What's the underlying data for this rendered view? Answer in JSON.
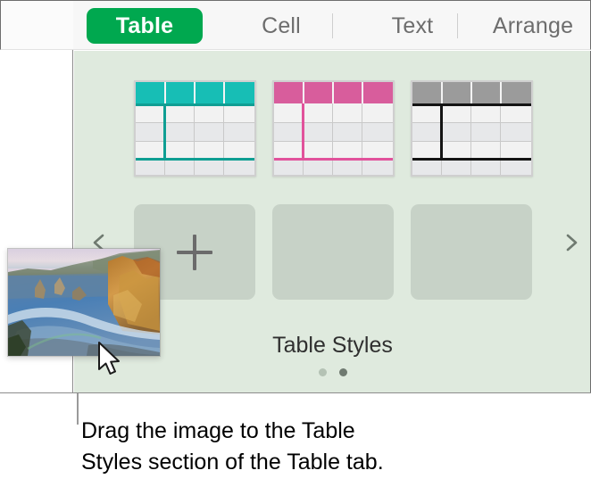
{
  "tabs": [
    {
      "id": "table",
      "label": "Table",
      "selected": true
    },
    {
      "id": "cell",
      "label": "Cell",
      "selected": false
    },
    {
      "id": "text",
      "label": "Text",
      "selected": false
    },
    {
      "id": "arrange",
      "label": "Arrange",
      "selected": false
    }
  ],
  "panel": {
    "title": "Table Styles",
    "background_color": "#dfeade",
    "prev_arrow_icon": "chevron-left-icon",
    "next_arrow_icon": "chevron-right-icon",
    "pagination": {
      "total": 2,
      "current": 2
    },
    "styles": [
      {
        "name": "teal-table-style",
        "accent_color": "#17beb5",
        "accent_dark": "#0f9e93"
      },
      {
        "name": "pink-table-style",
        "accent_color": "#d85d9c",
        "accent_dark": "#d44b92"
      },
      {
        "name": "gray-table-style",
        "accent_color": "#9b9b9b",
        "accent_dark": "#1a1a1a"
      }
    ],
    "empty_slots": [
      {
        "name": "add-style-slot",
        "icon": "plus-icon",
        "has_plus": true
      },
      {
        "name": "empty-style-slot",
        "icon": "",
        "has_plus": false
      },
      {
        "name": "empty-style-slot",
        "icon": "",
        "has_plus": false
      }
    ]
  },
  "drag": {
    "image_alt": "coastline-photo-thumbnail",
    "cursor_icon": "arrow-cursor-icon"
  },
  "caption": {
    "text": "Drag the image to the Table\nStyles section of the Table tab."
  },
  "colors": {
    "accent_green": "#00a84f",
    "tab_text": "#6d6d6d",
    "panel_bg": "#dfeade",
    "slot_bg": "#c7d2c7"
  }
}
